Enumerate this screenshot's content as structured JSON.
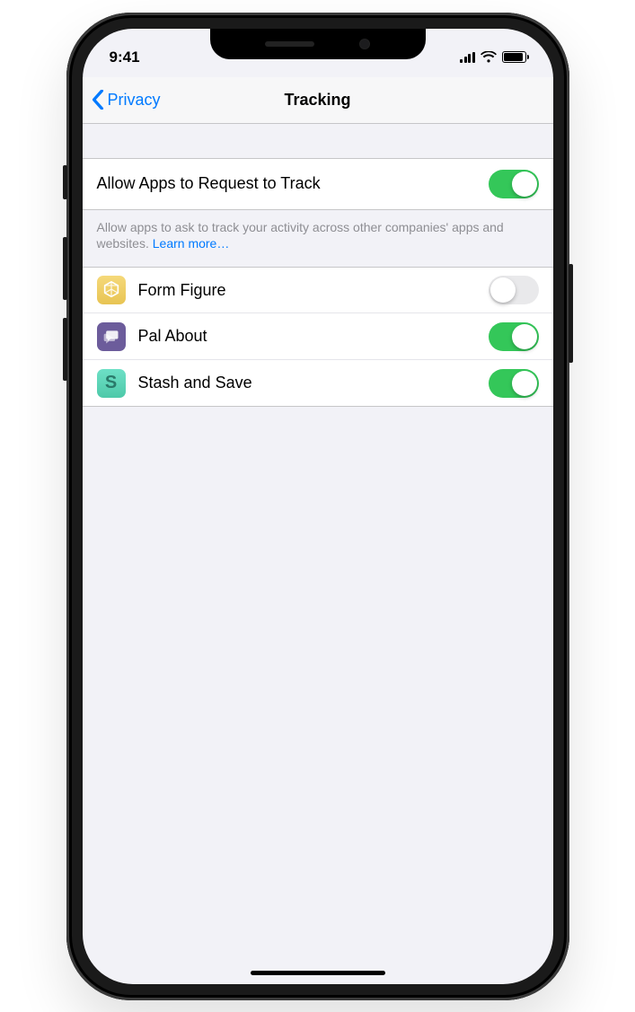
{
  "statusBar": {
    "time": "9:41"
  },
  "nav": {
    "back": "Privacy",
    "title": "Tracking"
  },
  "master": {
    "label": "Allow Apps to Request to Track",
    "on": true,
    "footer": "Allow apps to ask to track your activity across other companies' apps and websites. ",
    "learnMore": "Learn more…"
  },
  "apps": [
    {
      "name": "Form Figure",
      "iconClass": "form-figure",
      "on": false
    },
    {
      "name": "Pal About",
      "iconClass": "pal-about",
      "on": true
    },
    {
      "name": "Stash and Save",
      "iconClass": "stash-save",
      "on": true
    }
  ],
  "colors": {
    "accent": "#007aff",
    "toggleOn": "#34c759",
    "bg": "#f2f2f7"
  }
}
